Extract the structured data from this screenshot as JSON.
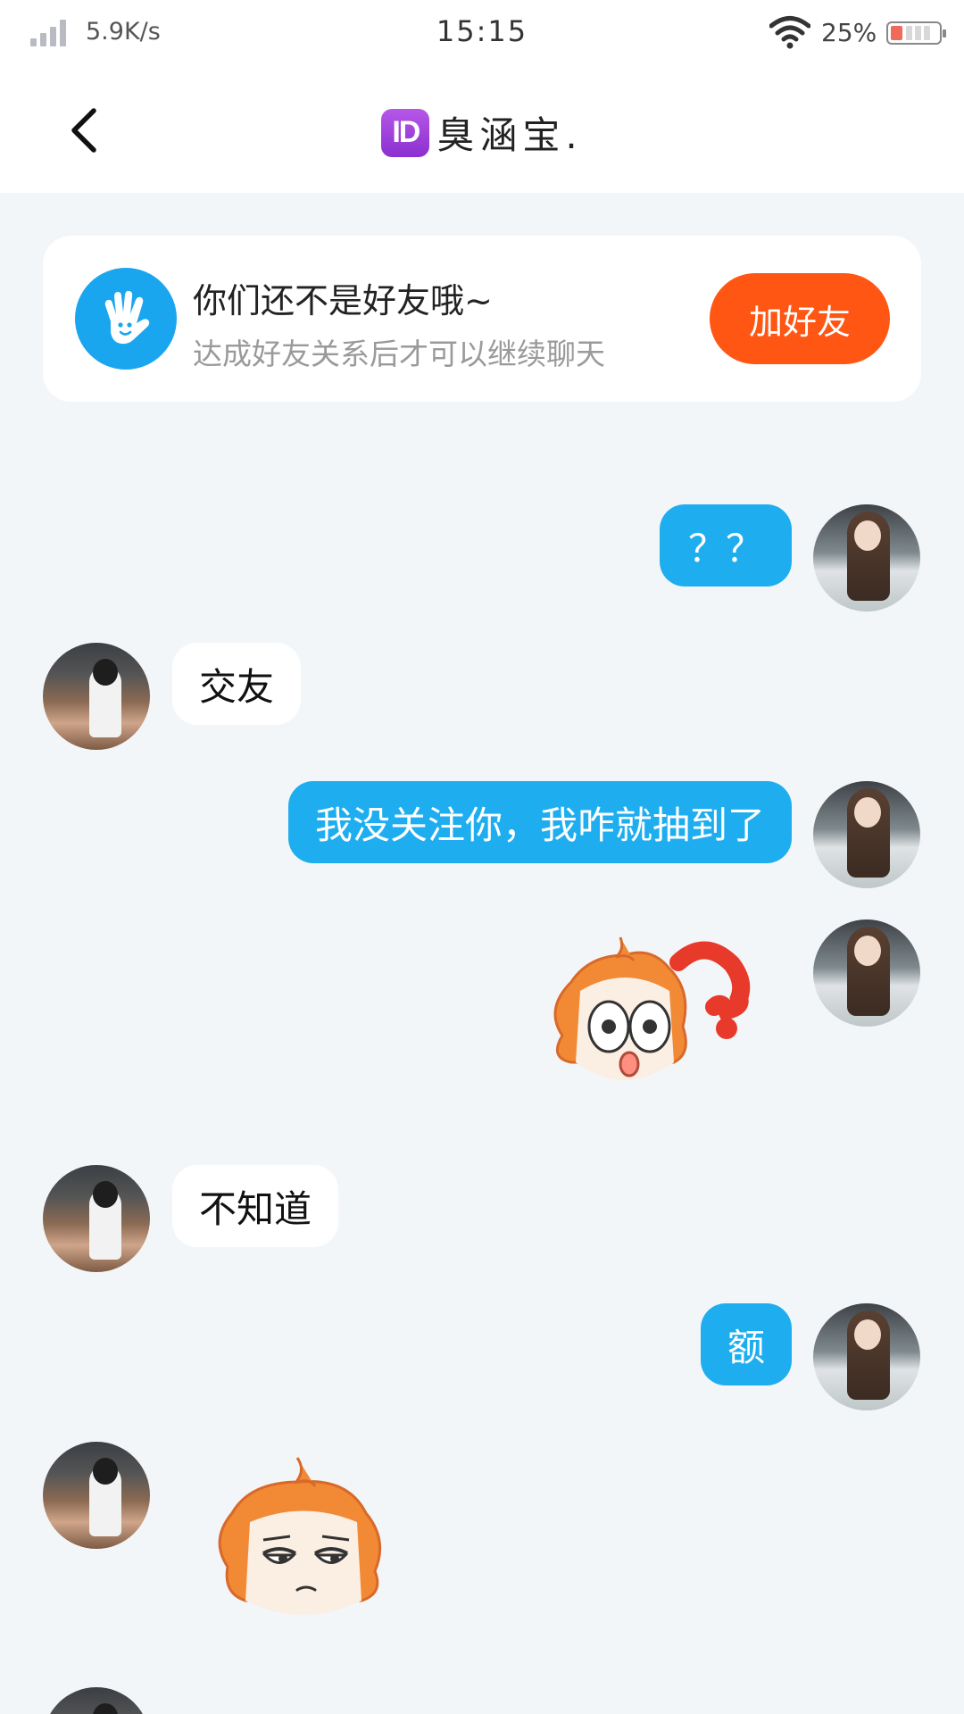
{
  "status_bar": {
    "net_speed": "5.9K/s",
    "time": "15:15",
    "battery_percent": "25%",
    "battery_level": 0.25,
    "icons": [
      "signal-icon",
      "wifi-icon",
      "battery-icon"
    ]
  },
  "nav": {
    "back_icon": "chevron-left-icon",
    "badge_text": "ID",
    "title": "臭涵宝."
  },
  "friend_banner": {
    "icon": "waving-hand-icon",
    "title": "你们还不是好友哦~",
    "subtitle": "达成好友关系后才可以继续聊天",
    "button_label": "加好友"
  },
  "messages": [
    {
      "side": "right",
      "type": "text",
      "text": "？？"
    },
    {
      "side": "left",
      "type": "text",
      "text": "交友"
    },
    {
      "side": "right",
      "type": "text",
      "text": "我没关注你，我咋就抽到了"
    },
    {
      "side": "right",
      "type": "sticker",
      "sticker": "confused-question-sticker"
    },
    {
      "side": "left",
      "type": "text",
      "text": "不知道"
    },
    {
      "side": "right",
      "type": "text",
      "text": "额"
    },
    {
      "side": "left",
      "type": "sticker",
      "sticker": "unimpressed-face-sticker"
    }
  ],
  "colors": {
    "outgoing_bubble": "#1eaef0",
    "add_friend_button": "#ff5613",
    "page_background": "#f3f6f9"
  }
}
